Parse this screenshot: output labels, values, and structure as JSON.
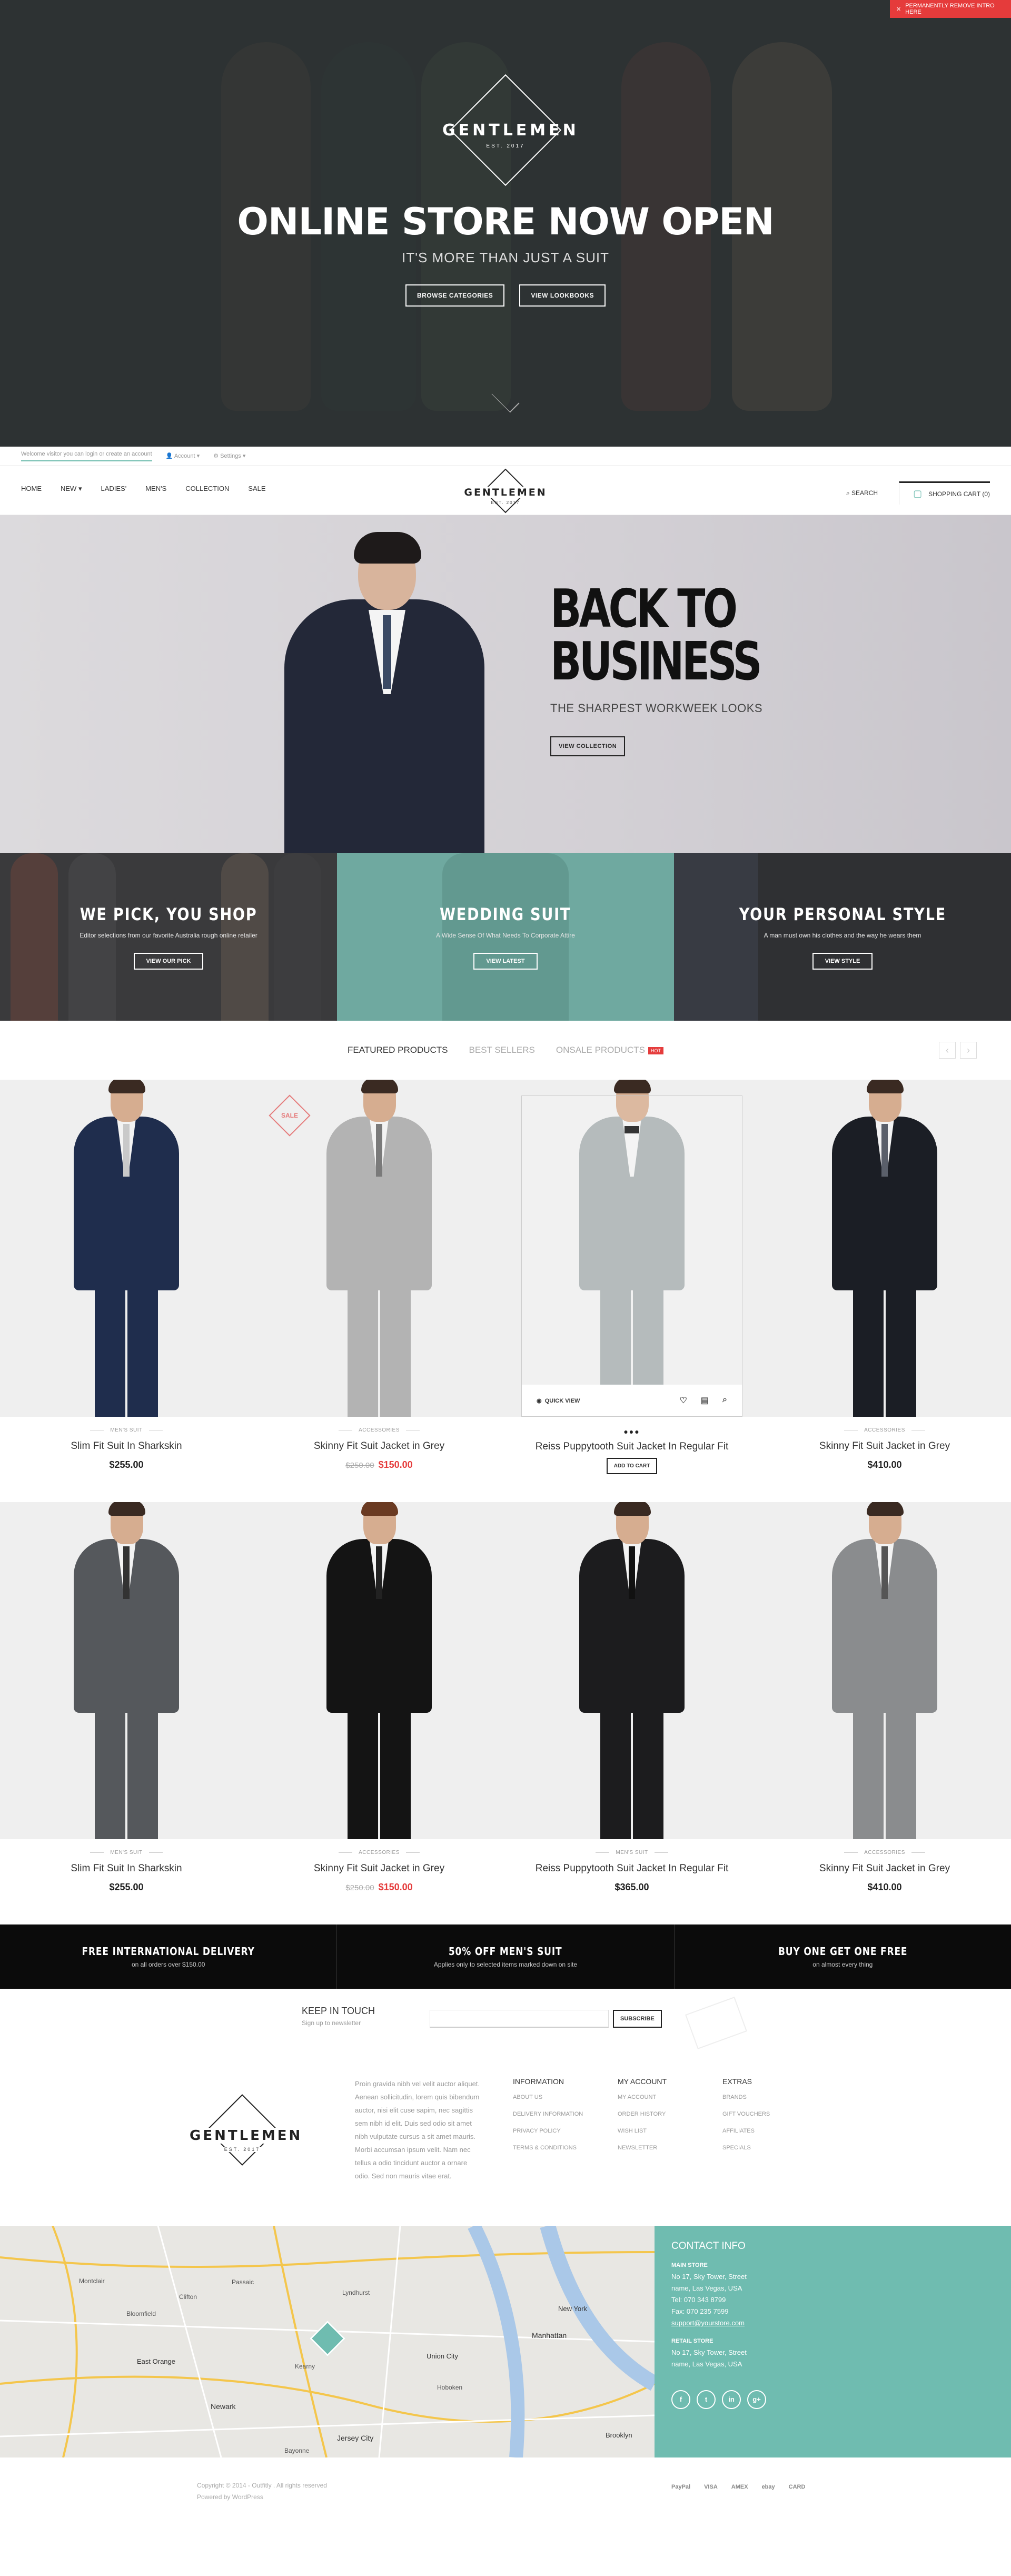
{
  "hero": {
    "promo_text": "PERMANENTLY REMOVE INTRO HERE",
    "logo_word": "GENTLEMEN",
    "logo_est": "EST. 2017",
    "title": "ONLINE STORE NOW OPEN",
    "subtitle": "IT'S MORE THAN JUST A SUIT",
    "btn_categories": "BROWSE CATEGORIES",
    "btn_lookbooks": "VIEW LOOKBOOKS"
  },
  "topbar": {
    "welcome": "Welcome visitor you can login or create an account",
    "account": "Account",
    "settings": "Settings"
  },
  "nav": {
    "items": [
      "HOME",
      "NEW",
      "LADIES'",
      "MEN'S",
      "COLLECTION",
      "SALE"
    ],
    "logo_word": "GENTLEMEN",
    "logo_est": "EST. 2017",
    "search": "SEARCH",
    "cart": "SHOPPING CART (0)"
  },
  "banner": {
    "title_line1": "BACK TO",
    "title_line2": "BUSINESS",
    "subtitle": "THE SHARPEST WORKWEEK LOOKS",
    "button": "VIEW COLLECTION"
  },
  "promos": [
    {
      "title": "WE PICK, YOU SHOP",
      "text": "Editor selections from our favorite Australia rough online retailer",
      "button": "VIEW OUR PICK"
    },
    {
      "title": "WEDDING SUIT",
      "text": "A Wide Sense Of What Needs To Corporate Attire",
      "button": "VIEW LATEST"
    },
    {
      "title": "YOUR PERSONAL STYLE",
      "text": "A man must own his clothes and the way he wears them",
      "button": "VIEW STYLE"
    }
  ],
  "tabs": {
    "featured": "FEATURED PRODUCTS",
    "best": "BEST SELLERS",
    "onsale": "ONSALE PRODUCTS",
    "hot": "HOT"
  },
  "products": [
    {
      "cat": "MEN'S SUIT",
      "name": "Slim Fit Suit In Sharkskin",
      "price": "$255.00"
    },
    {
      "cat": "ACCESSORIES",
      "name": "Skinny Fit Suit Jacket in Grey",
      "old": "$250.00",
      "price": "$150.00",
      "sale": "SALE"
    },
    {
      "cat": "●●●",
      "name": "Reiss Puppytooth Suit Jacket In Regular Fit",
      "button": "ADD TO CART",
      "quickview": "QUICK VIEW"
    },
    {
      "cat": "ACCESSORIES",
      "name": "Skinny Fit Suit Jacket in Grey",
      "price": "$410.00"
    },
    {
      "cat": "MEN'S SUIT",
      "name": "Slim Fit Suit In Sharkskin",
      "price": "$255.00"
    },
    {
      "cat": "ACCESSORIES",
      "name": "Skinny Fit Suit Jacket in Grey",
      "old": "$250.00",
      "price": "$150.00"
    },
    {
      "cat": "MEN'S SUIT",
      "name": "Reiss Puppytooth Suit Jacket In Regular Fit",
      "price": "$365.00"
    },
    {
      "cat": "ACCESSORIES",
      "name": "Skinny Fit Suit Jacket in Grey",
      "price": "$410.00"
    }
  ],
  "services": [
    {
      "title": "FREE INTERNATIONAL DELIVERY",
      "text": "on all orders over $150.00"
    },
    {
      "title": "50% OFF MEN'S SUIT",
      "text": "Applies only to selected items marked down on site"
    },
    {
      "title": "BUY ONE GET ONE FREE",
      "text": "on almost every thing"
    }
  ],
  "newsletter": {
    "title": "KEEP IN TOUCH",
    "sub": "Sign up to newsletter",
    "button": "SUBSCRIBE"
  },
  "footer": {
    "logo_word": "GENTLEMEN",
    "logo_est": "EST. 2017",
    "about": "Proin gravida nibh vel velit auctor aliquet. Aenean sollicitudin, lorem quis bibendum auctor, nisi elit cuse sapim, nec sagittis sem nibh id elit. Duis sed odio sit amet nibh vulputate cursus a sit amet mauris. Morbi accumsan ipsum velit. Nam nec tellus a odio tincidunt auctor a ornare odio. Sed non mauris vitae erat.",
    "cols": [
      {
        "title": "INFORMATION",
        "items": [
          "ABOUT US",
          "DELIVERY INFORMATION",
          "PRIVACY POLICY",
          "TERMS & CONDITIONS"
        ]
      },
      {
        "title": "MY ACCOUNT",
        "items": [
          "MY ACCOUNT",
          "ORDER HISTORY",
          "WISH LIST",
          "NEWSLETTER"
        ]
      },
      {
        "title": "EXTRAS",
        "items": [
          "BRANDS",
          "GIFT VOUCHERS",
          "AFFILIATES",
          "SPECIALS"
        ]
      }
    ]
  },
  "contact": {
    "title": "CONTACT INFO",
    "main_label": "MAIN STORE",
    "main_addr1": "No 17, Sky Tower, Street",
    "main_addr2": "name, Las Vegas, USA",
    "tel": "Tel: 070 343 8799",
    "fax": "Fax: 070 235 7599",
    "email": "support@yourstore.com",
    "retail_label": "RETAIL STORE",
    "retail_addr1": "No 17, Sky Tower, Street",
    "retail_addr2": "name, Las Vegas, USA",
    "social": [
      "f",
      "t",
      "in",
      "g+"
    ]
  },
  "map_labels": [
    "Montclair",
    "Clifton",
    "Passaic",
    "Union City",
    "Manhattan",
    "Newark",
    "East Orange",
    "Jersey City",
    "Bayonne",
    "New York",
    "Hoboken",
    "Kearny",
    "Bloomfield",
    "Lyndhurst",
    "Brooklyn"
  ],
  "bottom": {
    "copy1": "Copyright © 2014 - Outfitly . All rights reserved",
    "copy2": "Powered by WordPress",
    "payments": [
      "PayPal",
      "VISA",
      "AMEX",
      "ebay",
      "CARD"
    ]
  },
  "colors": {
    "accent": "#6fbcb0",
    "sale": "#e53b3b",
    "dark": "#0b0b0b"
  }
}
